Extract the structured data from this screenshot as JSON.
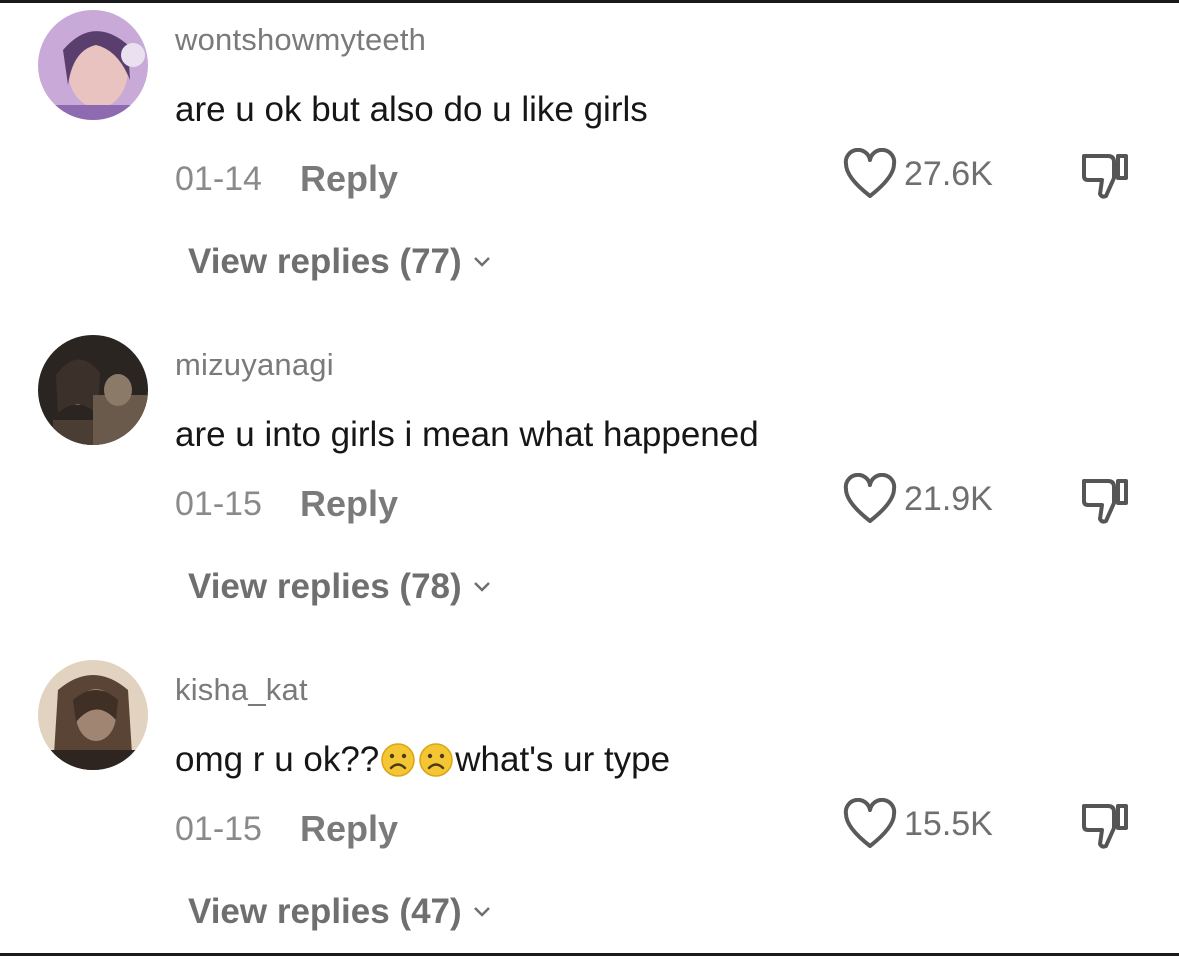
{
  "comments": [
    {
      "username": "wontshowmyteeth",
      "text_before_emoji": "are u ok but also do u like girls",
      "text_after_emoji": "",
      "date": "01-14",
      "reply_label": "Reply",
      "likes": "27.6K",
      "view_replies": "View replies (77)",
      "avatar_colors": [
        "#c9a9d8",
        "#8e6bb0",
        "#e8c3c0"
      ]
    },
    {
      "username": "mizuyanagi",
      "text_before_emoji": "are u into girls i mean what happened",
      "text_after_emoji": "",
      "date": "01-15",
      "reply_label": "Reply",
      "likes": "21.9K",
      "view_replies": "View replies (78)",
      "avatar_colors": [
        "#2b2521",
        "#6a5a4c",
        "#c7b6a3"
      ]
    },
    {
      "username": "kisha_kat",
      "text_before_emoji": "omg r u ok??",
      "text_after_emoji": "what's ur type",
      "date": "01-15",
      "reply_label": "Reply",
      "likes": "15.5K",
      "view_replies": "View replies (47)",
      "avatar_colors": [
        "#5a4436",
        "#a08672",
        "#e2d2c0"
      ]
    }
  ],
  "icons": {
    "like": "heart-outline-icon",
    "dislike": "thumbs-down-icon",
    "chevron": "chevron-down-icon",
    "emoji": "frowning-face-emoji"
  },
  "colors": {
    "username": "#7a7a7a",
    "text": "#161616",
    "meta": "#8a8a8a",
    "emoji": "#f5c634"
  }
}
